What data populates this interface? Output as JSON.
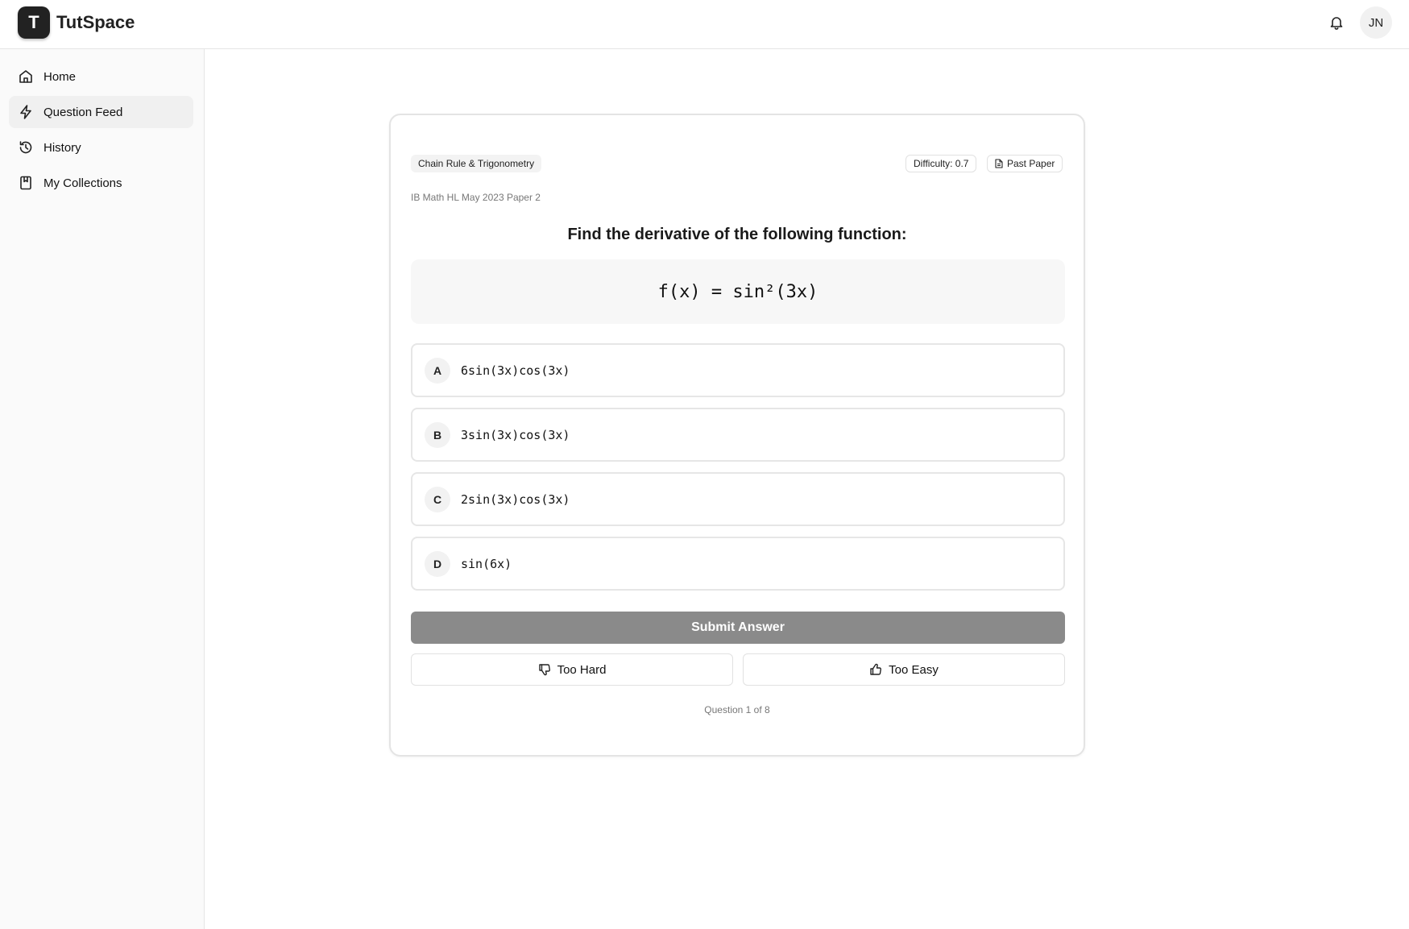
{
  "header": {
    "logo_letter": "T",
    "app_name": "TutSpace",
    "avatar_initials": "JN"
  },
  "sidebar": {
    "items": [
      {
        "label": "Home",
        "icon": "home-icon",
        "active": false
      },
      {
        "label": "Question Feed",
        "icon": "lightning-icon",
        "active": true
      },
      {
        "label": "History",
        "icon": "history-icon",
        "active": false
      },
      {
        "label": "My Collections",
        "icon": "collection-icon",
        "active": false
      }
    ]
  },
  "question": {
    "topic_tag": "Chain Rule & Trigonometry",
    "difficulty": "Difficulty: 0.7",
    "source_type": "Past Paper",
    "source": "IB Math HL May 2023 Paper 2",
    "prompt": "Find the derivative of the following function:",
    "formula": "f(x) = sin²(3x)",
    "options": [
      {
        "letter": "A",
        "text": "6sin(3x)cos(3x)"
      },
      {
        "letter": "B",
        "text": "3sin(3x)cos(3x)"
      },
      {
        "letter": "C",
        "text": "2sin(3x)cos(3x)"
      },
      {
        "letter": "D",
        "text": "sin(6x)"
      }
    ],
    "submit_label": "Submit Answer",
    "too_hard_label": "Too Hard",
    "too_easy_label": "Too Easy",
    "counter": "Question 1 of 8"
  },
  "colors": {
    "submit_disabled": "#8a8a8a",
    "logo_bg": "#222222",
    "active_nav_bg": "#f0f0f0"
  }
}
